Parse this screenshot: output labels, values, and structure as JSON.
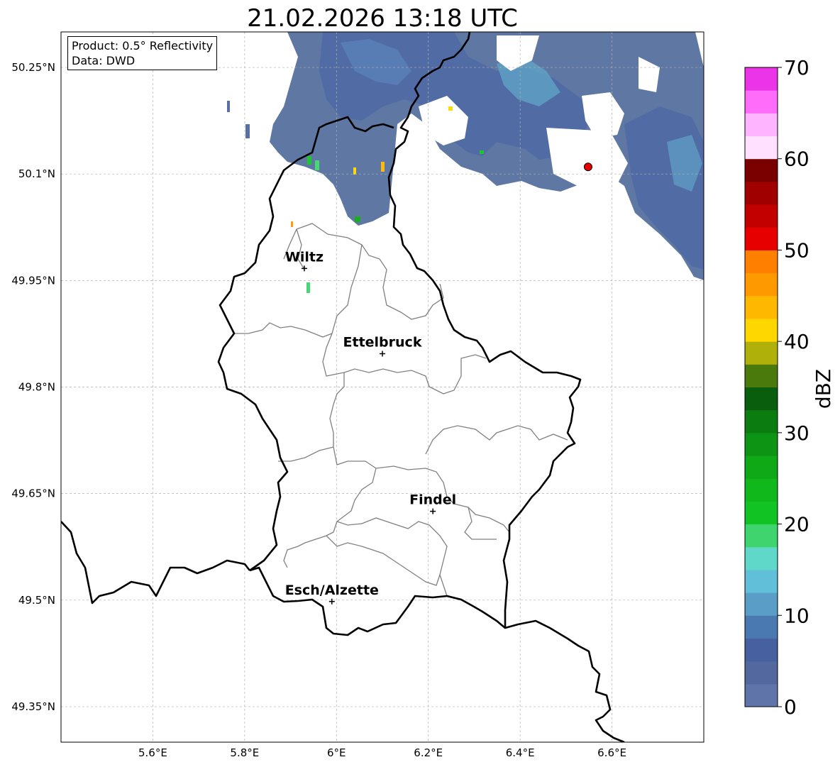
{
  "title": "21.02.2026 13:18 UTC",
  "info_box": {
    "product": "Product: 0.5° Reflectivity",
    "data": "Data: DWD"
  },
  "map": {
    "extent": {
      "lon_min": 5.4,
      "lon_max": 6.8,
      "lat_min": 49.3,
      "lat_max": 50.3
    },
    "lon_ticks": [
      {
        "value": 5.6,
        "label": "5.6°E"
      },
      {
        "value": 5.8,
        "label": "5.8°E"
      },
      {
        "value": 6.0,
        "label": "6°E"
      },
      {
        "value": 6.2,
        "label": "6.2°E"
      },
      {
        "value": 6.4,
        "label": "6.4°E"
      },
      {
        "value": 6.6,
        "label": "6.6°E"
      }
    ],
    "lat_ticks": [
      {
        "value": 50.25,
        "label": "50.25°N"
      },
      {
        "value": 50.1,
        "label": "50.1°N"
      },
      {
        "value": 49.95,
        "label": "49.95°N"
      },
      {
        "value": 49.8,
        "label": "49.8°N"
      },
      {
        "value": 49.65,
        "label": "49.65°N"
      },
      {
        "value": 49.5,
        "label": "49.5°N"
      },
      {
        "value": 49.35,
        "label": "49.35°N"
      }
    ],
    "cities": [
      {
        "name": "Wiltz",
        "lon": 5.93,
        "lat": 49.967
      },
      {
        "name": "Ettelbruck",
        "lon": 6.1,
        "lat": 49.847
      },
      {
        "name": "Findel",
        "lon": 6.21,
        "lat": 49.625
      },
      {
        "name": "Esch/Alzette",
        "lon": 5.99,
        "lat": 49.498
      }
    ],
    "radar_site": {
      "lon": 6.548,
      "lat": 50.11,
      "color": "#e60000"
    },
    "colors": {
      "border": "#000000",
      "cantons": "#808080",
      "grid": "#b0b0b0"
    }
  },
  "colorbar": {
    "label": "dBZ",
    "min": 0,
    "max": 70,
    "ticks": [
      0,
      10,
      20,
      30,
      40,
      50,
      60,
      70
    ],
    "colors": [
      "#5f74a8",
      "#52689f",
      "#4660a0",
      "#4a79b1",
      "#5a9dc6",
      "#62bfd9",
      "#5fd7c9",
      "#40d46e",
      "#12c423",
      "#10b81c",
      "#0fa817",
      "#0d9414",
      "#0b7c10",
      "#095e0d",
      "#4a7a0c",
      "#afb00a",
      "#ffd700",
      "#ffb800",
      "#ff9900",
      "#ff7f00",
      "#e60000",
      "#c20000",
      "#a00000",
      "#7a0000",
      "#ffe0ff",
      "#ffb4ff",
      "#ff6cfa",
      "#eb33e8"
    ]
  }
}
